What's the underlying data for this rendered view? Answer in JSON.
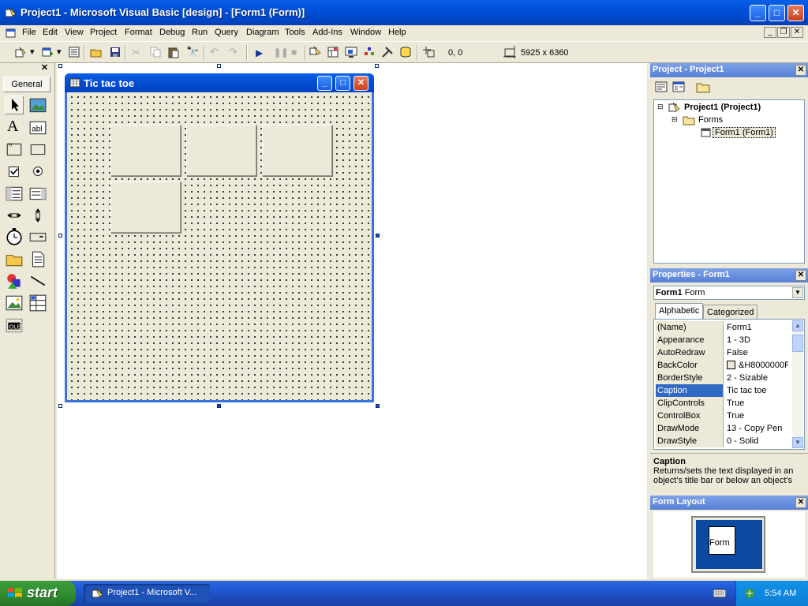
{
  "window": {
    "title": "Project1 - Microsoft Visual Basic [design] - [Form1 (Form)]",
    "buttons": [
      "minimize",
      "maximize",
      "close"
    ]
  },
  "menu": {
    "items": [
      "File",
      "Edit",
      "View",
      "Project",
      "Format",
      "Debug",
      "Run",
      "Query",
      "Diagram",
      "Tools",
      "Add-Ins",
      "Window",
      "Help"
    ]
  },
  "toolbar": {
    "position_readout": "0, 0",
    "size_readout": "5925 x 6360"
  },
  "toolbox": {
    "tab_label": "General",
    "close_label": "✕"
  },
  "form": {
    "caption": "Tic tac toe"
  },
  "project_panel": {
    "title": "Project - Project1",
    "close_label": "✕",
    "tree": {
      "root": "Project1 (Project1)",
      "folder": "Forms",
      "leaf": "Form1 (Form1)"
    }
  },
  "properties_panel": {
    "title": "Properties - Form1",
    "close_label": "✕",
    "object_name": "Form1",
    "object_type": "Form",
    "tabs": [
      "Alphabetic",
      "Categorized"
    ],
    "rows": [
      {
        "name": "(Name)",
        "value": "Form1"
      },
      {
        "name": "Appearance",
        "value": "1 - 3D"
      },
      {
        "name": "AutoRedraw",
        "value": "False"
      },
      {
        "name": "BackColor",
        "value": "&H8000000F"
      },
      {
        "name": "BorderStyle",
        "value": "2 - Sizable"
      },
      {
        "name": "Caption",
        "value": "Tic tac toe"
      },
      {
        "name": "ClipControls",
        "value": "True"
      },
      {
        "name": "ControlBox",
        "value": "True"
      },
      {
        "name": "DrawMode",
        "value": "13 - Copy Pen"
      },
      {
        "name": "DrawStyle",
        "value": "0 - Solid"
      }
    ],
    "selected_row": "Caption"
  },
  "description": {
    "title": "Caption",
    "text": "Returns/sets the text displayed in an object's title bar or below an object's"
  },
  "layout_panel": {
    "title": "Form Layout",
    "close_label": "✕",
    "mini_form_label": "Form"
  },
  "taskbar": {
    "start_label": "start",
    "task_label": "Project1 - Microsoft V...",
    "clock": "5:54 AM"
  },
  "colors": {
    "titlebar": "#0050d8",
    "selection": "#316ac5",
    "taskbar": "#245edb",
    "start": "#2f8a2f"
  }
}
